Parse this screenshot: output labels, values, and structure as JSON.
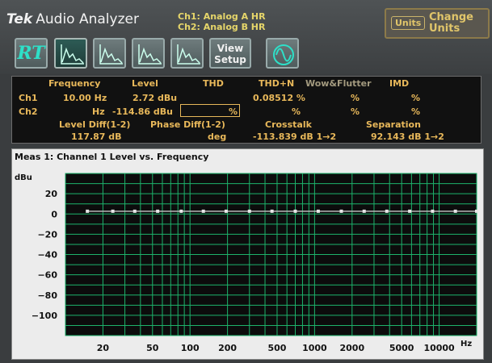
{
  "app": {
    "brand": "Tek",
    "name": "Audio Analyzer"
  },
  "channels": {
    "ch1": "Ch1: Analog A HR",
    "ch2": "Ch2: Analog B HR"
  },
  "units_button": {
    "small": "Units",
    "line1": "Change",
    "line2": "Units"
  },
  "toolbar": {
    "rt_label": "RT",
    "view_setup_line1": "View",
    "view_setup_line2": "Setup",
    "icons": [
      "rt-icon",
      "graph-icon",
      "graph-icon",
      "graph-icon",
      "graph-icon",
      "sine-wave-icon"
    ]
  },
  "meas": {
    "headers": {
      "frequency": "Frequency",
      "level": "Level",
      "thd": "THD",
      "thdn": "THD+N",
      "wow": "Wow&Flutter",
      "imd": "IMD"
    },
    "ch1": {
      "label": "Ch1",
      "frequency": "10.00 Hz",
      "level": "2.72 dBu",
      "thdn": "0.08512 %",
      "wow": "%",
      "imd": "%"
    },
    "ch2": {
      "label": "Ch2",
      "frequency": "Hz",
      "level": "-114.86 dBu",
      "thd": "%",
      "thdn": "%",
      "wow": "%",
      "imd": "%"
    },
    "row3_headers": {
      "level_diff": "Level Diff(1-2)",
      "phase_diff": "Phase Diff(1-2)",
      "crosstalk": "Crosstalk",
      "separation": "Separation"
    },
    "row3": {
      "level_diff": "117.87 dB",
      "phase_diff": "deg",
      "crosstalk": "-113.839 dB 1→2",
      "separation": "92.143 dB 1→2"
    }
  },
  "graph": {
    "title": "Meas 1: Channel 1 Level vs. Frequency",
    "y_unit": "dBu",
    "x_unit": "Hz"
  },
  "chart_data": {
    "type": "line",
    "title": "Meas 1: Channel 1 Level vs. Frequency",
    "ylabel": "dBu",
    "xlabel": "Hz",
    "x_scale": "log",
    "xlim": [
      10,
      20000
    ],
    "ylim": [
      -120,
      40
    ],
    "grid": true,
    "x_ticks": [
      20,
      50,
      100,
      200,
      500,
      1000,
      2000,
      5000,
      10000
    ],
    "x_tick_labels": [
      "20",
      "50",
      "100",
      "200",
      "500",
      "1000",
      "2000",
      "5000",
      "10000"
    ],
    "y_ticks": [
      20,
      0,
      -20,
      -40,
      -60,
      -80,
      -100
    ],
    "y_tick_labels": [
      "20",
      "0",
      "−20",
      "−40",
      "−60",
      "−80",
      "−100"
    ],
    "series": [
      {
        "x": [
          15,
          24,
          36,
          55,
          85,
          128,
          195,
          300,
          455,
          700,
          1070,
          1640,
          2500,
          3800,
          5800,
          8850,
          13500,
          20000
        ],
        "y": [
          2.7,
          2.7,
          2.7,
          2.7,
          2.7,
          2.7,
          2.7,
          2.7,
          2.7,
          2.7,
          2.7,
          2.7,
          2.7,
          2.7,
          2.7,
          2.7,
          2.7,
          2.7
        ]
      }
    ],
    "colors": {
      "grid": "#1db36b",
      "line": "#b9b9b9",
      "plot_bg": "#0c0c0c"
    }
  }
}
